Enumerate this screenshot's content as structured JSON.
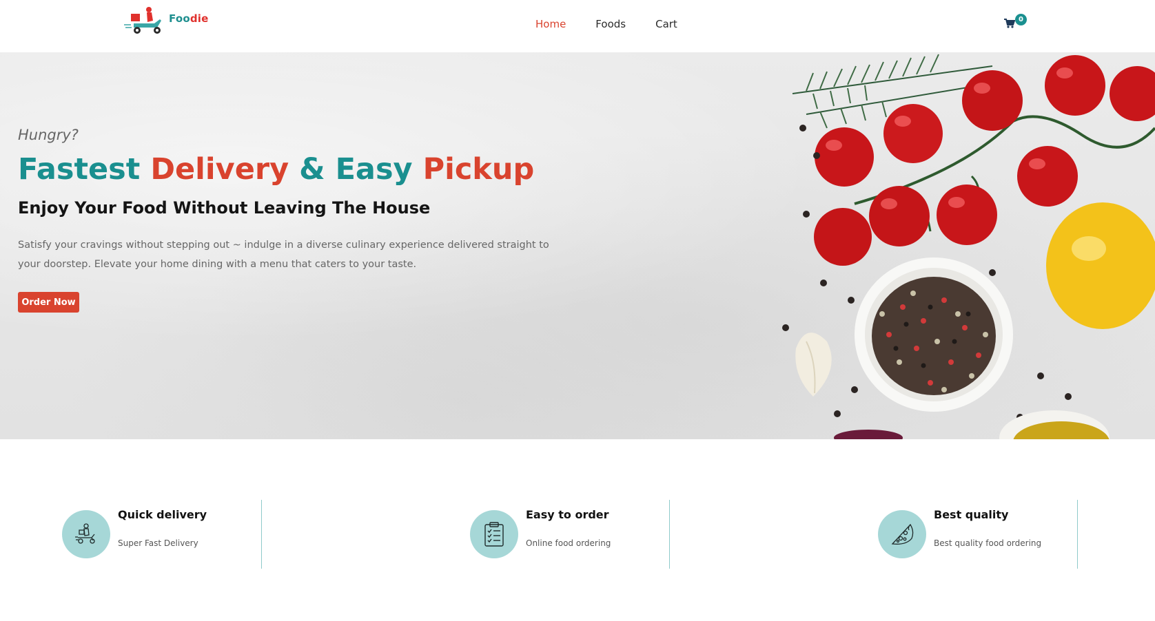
{
  "brand": {
    "name_part1": "Foo",
    "name_part2": "die"
  },
  "nav": {
    "items": [
      {
        "label": "Home",
        "active": true
      },
      {
        "label": "Foods",
        "active": false
      },
      {
        "label": "Cart",
        "active": false
      }
    ]
  },
  "cart": {
    "icon": "cart-icon",
    "count": "0"
  },
  "hero": {
    "eyebrow": "Hungry?",
    "headline": {
      "w1": "Fastest",
      "w2": "Delivery",
      "w3": "&",
      "w4": "Easy",
      "w5": "Pickup"
    },
    "subheading": "Enjoy Your Food Without Leaving The House",
    "description": "Satisfy your cravings without stepping out ~ indulge in a diverse culinary experience delivered straight to your doorstep. Elevate your home dining with a menu that caters to your taste.",
    "cta_label": "Order Now"
  },
  "features": [
    {
      "title": "Quick delivery",
      "description": "Super Fast Delivery",
      "icon": "delivery-scooter-icon"
    },
    {
      "title": "Easy to order",
      "description": "Online food ordering",
      "icon": "clipboard-checklist-icon"
    },
    {
      "title": "Best quality",
      "description": "Best quality food ordering",
      "icon": "pizza-icon"
    }
  ],
  "colors": {
    "accent_teal": "#1a8f8f",
    "accent_red": "#d9432e",
    "feature_circle": "#a6d7d7"
  }
}
